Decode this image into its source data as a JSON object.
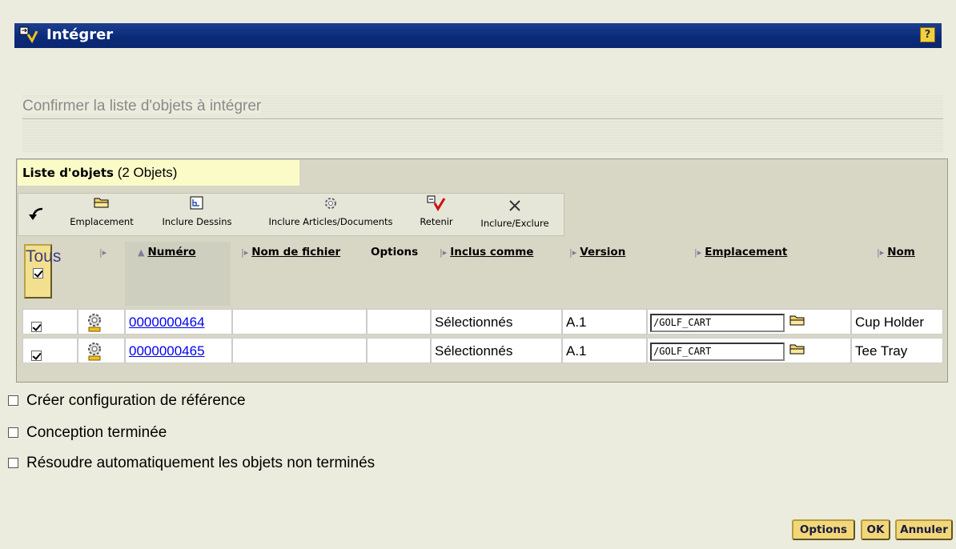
{
  "window": {
    "title": "Intégrer",
    "help_label": "?"
  },
  "section": {
    "heading": "Confirmer la liste d'objets à intégrer"
  },
  "list": {
    "title_bold": "Liste d'objets",
    "count": "(2 Objets)",
    "toolbar": [
      {
        "label": "Emplacement",
        "icon": "folder-icon"
      },
      {
        "label": "Inclure Dessins",
        "icon": "drawing-icon"
      },
      {
        "label": "Inclure Articles/Documents",
        "icon": "gear-icon"
      },
      {
        "label": "Retenir",
        "icon": "retain-icon"
      },
      {
        "label": "Inclure/Exclure",
        "icon": "close-icon"
      }
    ],
    "all_label": "Tous",
    "columns": {
      "numero": "Numéro",
      "nom_fichier": "Nom de fichier",
      "options": "Options",
      "inclus_comme": "Inclus comme",
      "version": "Version",
      "emplacement": "Emplacement",
      "nom": "Nom"
    },
    "rows": [
      {
        "checked": true,
        "numero": "0000000464",
        "nom_fichier": "",
        "options": "",
        "inclus_comme": "Sélectionnés",
        "version": "A.1",
        "emplacement": "/GOLF_CART",
        "nom": "Cup Holder"
      },
      {
        "checked": true,
        "numero": "0000000465",
        "nom_fichier": "",
        "options": "",
        "inclus_comme": "Sélectionnés",
        "version": "A.1",
        "emplacement": "/GOLF_CART",
        "nom": "Tee Tray"
      }
    ]
  },
  "options": [
    {
      "label": "Créer configuration de référence",
      "checked": false
    },
    {
      "label": "Conception terminée",
      "checked": false
    },
    {
      "label": "Résoudre automatiquement les objets non terminés",
      "checked": false
    }
  ],
  "buttons": {
    "options": "Options",
    "ok": "OK",
    "cancel": "Annuler"
  },
  "colors": {
    "titlebar": "#0a2a78",
    "panel_header": "#fbfbc8",
    "button": "#f2d77a",
    "link": "#0000ee"
  }
}
